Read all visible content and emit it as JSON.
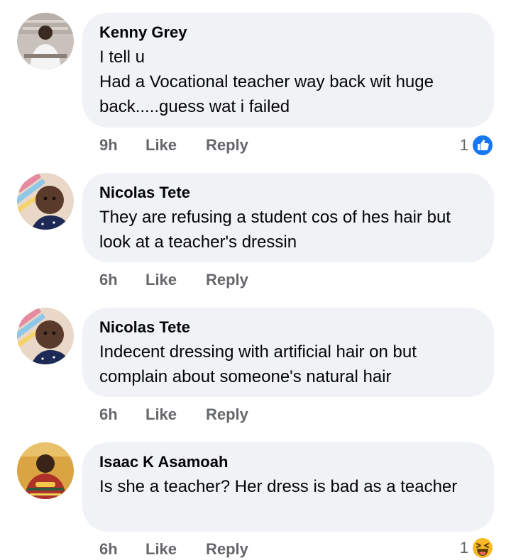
{
  "comments": [
    {
      "author": "Kenny Grey",
      "text": "I tell u\nHad a Vocational teacher way back wit huge back.....guess wat i failed",
      "time": "9h",
      "like_label": "Like",
      "reply_label": "Reply",
      "reaction_count": "1",
      "reaction_type": "like-icon"
    },
    {
      "author": "Nicolas Tete",
      "text": "They are refusing a student cos of hes hair but look at a teacher's dressin",
      "time": "6h",
      "like_label": "Like",
      "reply_label": "Reply"
    },
    {
      "author": "Nicolas Tete",
      "text": "Indecent dressing with artificial hair on but complain about someone's natural hair",
      "time": "6h",
      "like_label": "Like",
      "reply_label": "Reply"
    },
    {
      "author": "Isaac K Asamoah",
      "text": "Is she a teacher? Her dress is bad as a teacher",
      "time": "6h",
      "like_label": "Like",
      "reply_label": "Reply",
      "reaction_count": "1",
      "reaction_type": "haha-emoji-icon"
    }
  ],
  "colors": {
    "bubble": "#f0f2f5",
    "meta_text": "#65676b",
    "like_blue": "#1877f2",
    "haha_yellow": "#f7b928"
  }
}
